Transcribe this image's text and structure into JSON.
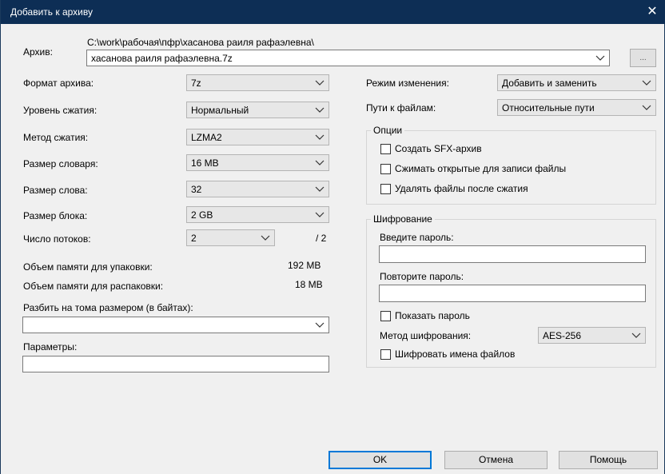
{
  "window": {
    "title": "Добавить к архиву",
    "close_glyph": "✕"
  },
  "archive": {
    "label": "Архив:",
    "path": "C:\\work\\рабочая\\пфр\\хасанова раиля рафаэлевна\\",
    "filename": "хасанова раиля рафаэлевна.7z",
    "browse_label": "..."
  },
  "left": {
    "format": {
      "label": "Формат архива:",
      "value": "7z"
    },
    "level": {
      "label": "Уровень сжатия:",
      "value": "Нормальный"
    },
    "method": {
      "label": "Метод сжатия:",
      "value": "LZMA2"
    },
    "dict": {
      "label": "Размер словаря:",
      "value": "16 MB"
    },
    "word": {
      "label": "Размер слова:",
      "value": "32"
    },
    "block": {
      "label": "Размер блока:",
      "value": "2 GB"
    },
    "threads": {
      "label": "Число потоков:",
      "value": "2",
      "max": "/ 2"
    },
    "mem_pack": {
      "label": "Объем памяти для упаковки:",
      "value": "192 MB"
    },
    "mem_unpack": {
      "label": "Объем памяти для распаковки:",
      "value": "18 MB"
    },
    "split": {
      "label": "Разбить на тома размером (в байтах):",
      "value": ""
    },
    "params": {
      "label": "Параметры:",
      "value": ""
    }
  },
  "right": {
    "mode": {
      "label": "Режим изменения:",
      "value": "Добавить и заменить"
    },
    "paths": {
      "label": "Пути к файлам:",
      "value": "Относительные пути"
    },
    "options": {
      "title": "Опции",
      "sfx": "Создать SFX-архив",
      "shared": "Сжимать открытые для записи файлы",
      "delete": "Удалять файлы после сжатия"
    },
    "encryption": {
      "title": "Шифрование",
      "password_label": "Введите пароль:",
      "repeat_label": "Повторите пароль:",
      "show_password": "Показать пароль",
      "method_label": "Метод шифрования:",
      "method_value": "AES-256",
      "encrypt_names": "Шифровать имена файлов"
    }
  },
  "buttons": {
    "ok": "OK",
    "cancel": "Отмена",
    "help": "Помощь"
  }
}
